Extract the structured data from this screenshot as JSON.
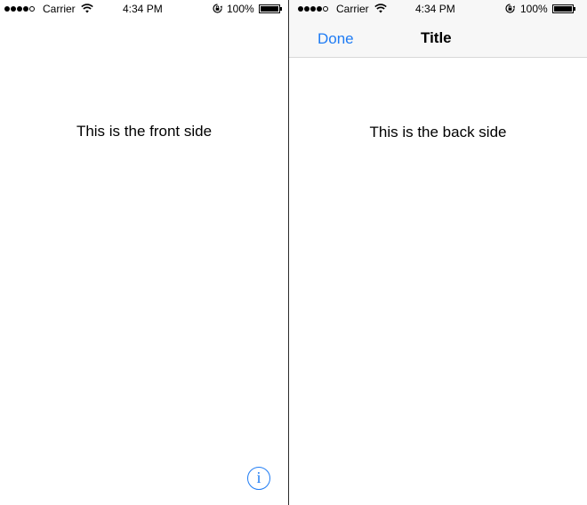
{
  "front": {
    "status_bar": {
      "signal_dots": 5,
      "signal_filled": 4,
      "carrier": "Carrier",
      "wifi_icon": "wifi-icon",
      "time": "4:34 PM",
      "rotation_lock_icon": "rotation-lock-icon",
      "battery_percent": "100%",
      "battery_level": 1.0
    },
    "label": "This is the front side",
    "info_button": {
      "icon": "info-icon",
      "glyph": "i"
    }
  },
  "back": {
    "status_bar": {
      "signal_dots": 5,
      "signal_filled": 4,
      "carrier": "Carrier",
      "wifi_icon": "wifi-icon",
      "time": "4:34 PM",
      "rotation_lock_icon": "rotation-lock-icon",
      "battery_percent": "100%",
      "battery_level": 1.0
    },
    "navbar": {
      "done_label": "Done",
      "title": "Title"
    },
    "label": "This is the back side"
  },
  "colors": {
    "tint": "#1f7cf4",
    "navbar_background": "#f7f7f7",
    "background": "#ffffff",
    "divider": "#2b2b2b"
  }
}
